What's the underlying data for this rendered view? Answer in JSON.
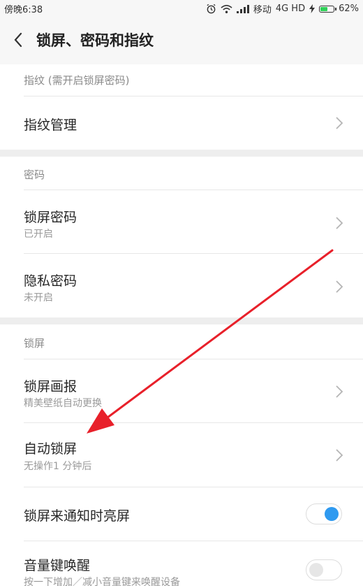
{
  "status_bar": {
    "time": "傍晚6:38",
    "carrier": "移动",
    "network": "4G HD",
    "battery_percent": "62%",
    "battery_level": 0.62
  },
  "header": {
    "title": "锁屏、密码和指纹",
    "back_icon": "chevron-left-icon"
  },
  "sections": [
    {
      "title": "指纹 (需开启锁屏密码)",
      "items": [
        {
          "title": "指纹管理",
          "control": "chevron"
        }
      ]
    },
    {
      "title": "密码",
      "items": [
        {
          "title": "锁屏密码",
          "subtitle": "已开启",
          "control": "chevron"
        },
        {
          "title": "隐私密码",
          "subtitle": "未开启",
          "control": "chevron"
        }
      ]
    },
    {
      "title": "锁屏",
      "items": [
        {
          "title": "锁屏画报",
          "subtitle": "精美壁纸自动更换",
          "control": "chevron"
        },
        {
          "title": "自动锁屏",
          "subtitle": "无操作1 分钟后",
          "control": "chevron"
        },
        {
          "title": "锁屏来通知时亮屏",
          "control": "toggle",
          "state": "on"
        },
        {
          "title": "音量键唤醒",
          "subtitle": "按一下增加／减小音量键来唤醒设备",
          "control": "toggle",
          "state": "off"
        }
      ]
    }
  ],
  "colors": {
    "toggle_on_accent": "#2f9af0",
    "annotation_arrow": "#e8202a",
    "battery_fill": "#2fd058"
  }
}
